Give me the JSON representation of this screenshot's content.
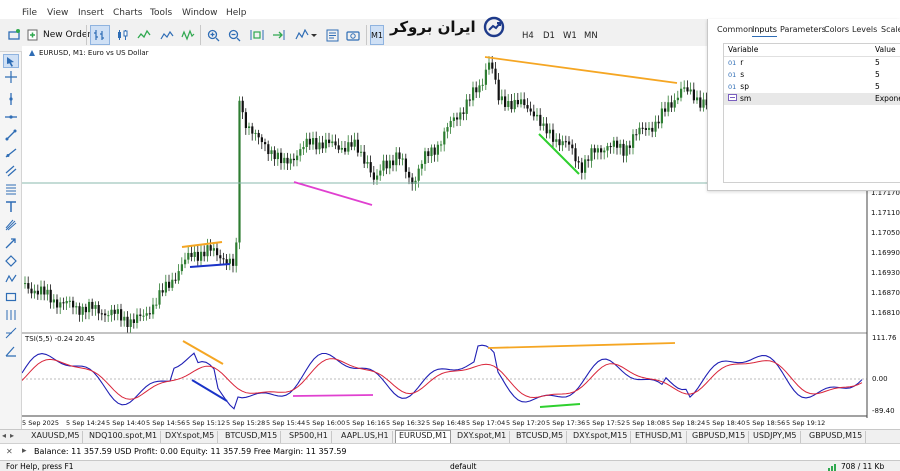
{
  "menu": {
    "items": [
      "File",
      "View",
      "Insert",
      "Charts",
      "Tools",
      "Window",
      "Help"
    ]
  },
  "toolbar": {
    "new_order_label": "New Order",
    "timeframes": [
      "M1",
      "H4",
      "D1",
      "W1",
      "MN"
    ],
    "active_timeframe": "M1"
  },
  "logo": {
    "text": "ایران بروکر"
  },
  "chart": {
    "symbol_label": "EURUSD, M1:  Euro vs US Dollar",
    "indicator_label": "TSI(5,5) -0.24 20.45",
    "price_ticks": [
      "1.17170",
      "1.17110",
      "1.17050",
      "1.16990",
      "1.16930",
      "1.16870",
      "1.16810"
    ],
    "tsi_ticks": [
      "111.76",
      "0.00",
      "-89.40"
    ],
    "time_ticks": [
      "5 Sep 2025",
      "5 Sep 14:24",
      "5 Sep 14:40",
      "5 Sep 14:56",
      "5 Sep 15:12",
      "5 Sep 15:28",
      "5 Sep 15:44",
      "5 Sep 16:00",
      "5 Sep 16:16",
      "5 Sep 16:32",
      "5 Sep 16:48",
      "5 Sep 17:04",
      "5 Sep 17:20",
      "5 Sep 17:36",
      "5 Sep 17:52",
      "5 Sep 18:08",
      "5 Sep 18:24",
      "5 Sep 18:40",
      "5 Sep 18:56",
      "5 Sep 19:12"
    ],
    "colors": {
      "bull": "#2e7d32",
      "bear": "#111111",
      "tsi": "#1f1fb4",
      "signal": "#d9253a",
      "orange": "#f5a623",
      "blue": "#1a33c8",
      "magenta": "#e040d0",
      "green": "#2fd02f",
      "hline": "#7fb3a8"
    }
  },
  "properties": {
    "tabs": [
      "Common",
      "Inputs",
      "Parameters",
      "Colors",
      "Levels",
      "Scale"
    ],
    "active_tab": "Inputs",
    "columns": [
      "Variable",
      "Value"
    ],
    "rows": [
      {
        "type": "01",
        "name": "r",
        "value": "5"
      },
      {
        "type": "01",
        "name": "s",
        "value": "5"
      },
      {
        "type": "01",
        "name": "sp",
        "value": "5"
      },
      {
        "type": "enum",
        "name": "sm",
        "value": "Exponer"
      }
    ]
  },
  "symbol_tabs": {
    "items": [
      "XAUUSD,M5",
      "NDQ100.spot,M1",
      "DXY.spot,M5",
      "BTCUSD,M15",
      "SP500,H1",
      "AAPL.US,H1",
      "EURUSD,M1",
      "DXY.spot,M1",
      "BTCUSD,M5",
      "DXY.spot,M15",
      "ETHUSD,M1",
      "GBPUSD,M15",
      "USDJPY,M5",
      "GBPUSD,M15"
    ],
    "active": "EURUSD,M1"
  },
  "balance": {
    "text": "Balance: 11 357.59 USD  Profit: 0.00  Equity: 11 357.59  Free Margin: 11 357.59"
  },
  "status": {
    "help": "For Help, press F1",
    "profile": "default",
    "traffic": "708 / 11 Kb"
  }
}
